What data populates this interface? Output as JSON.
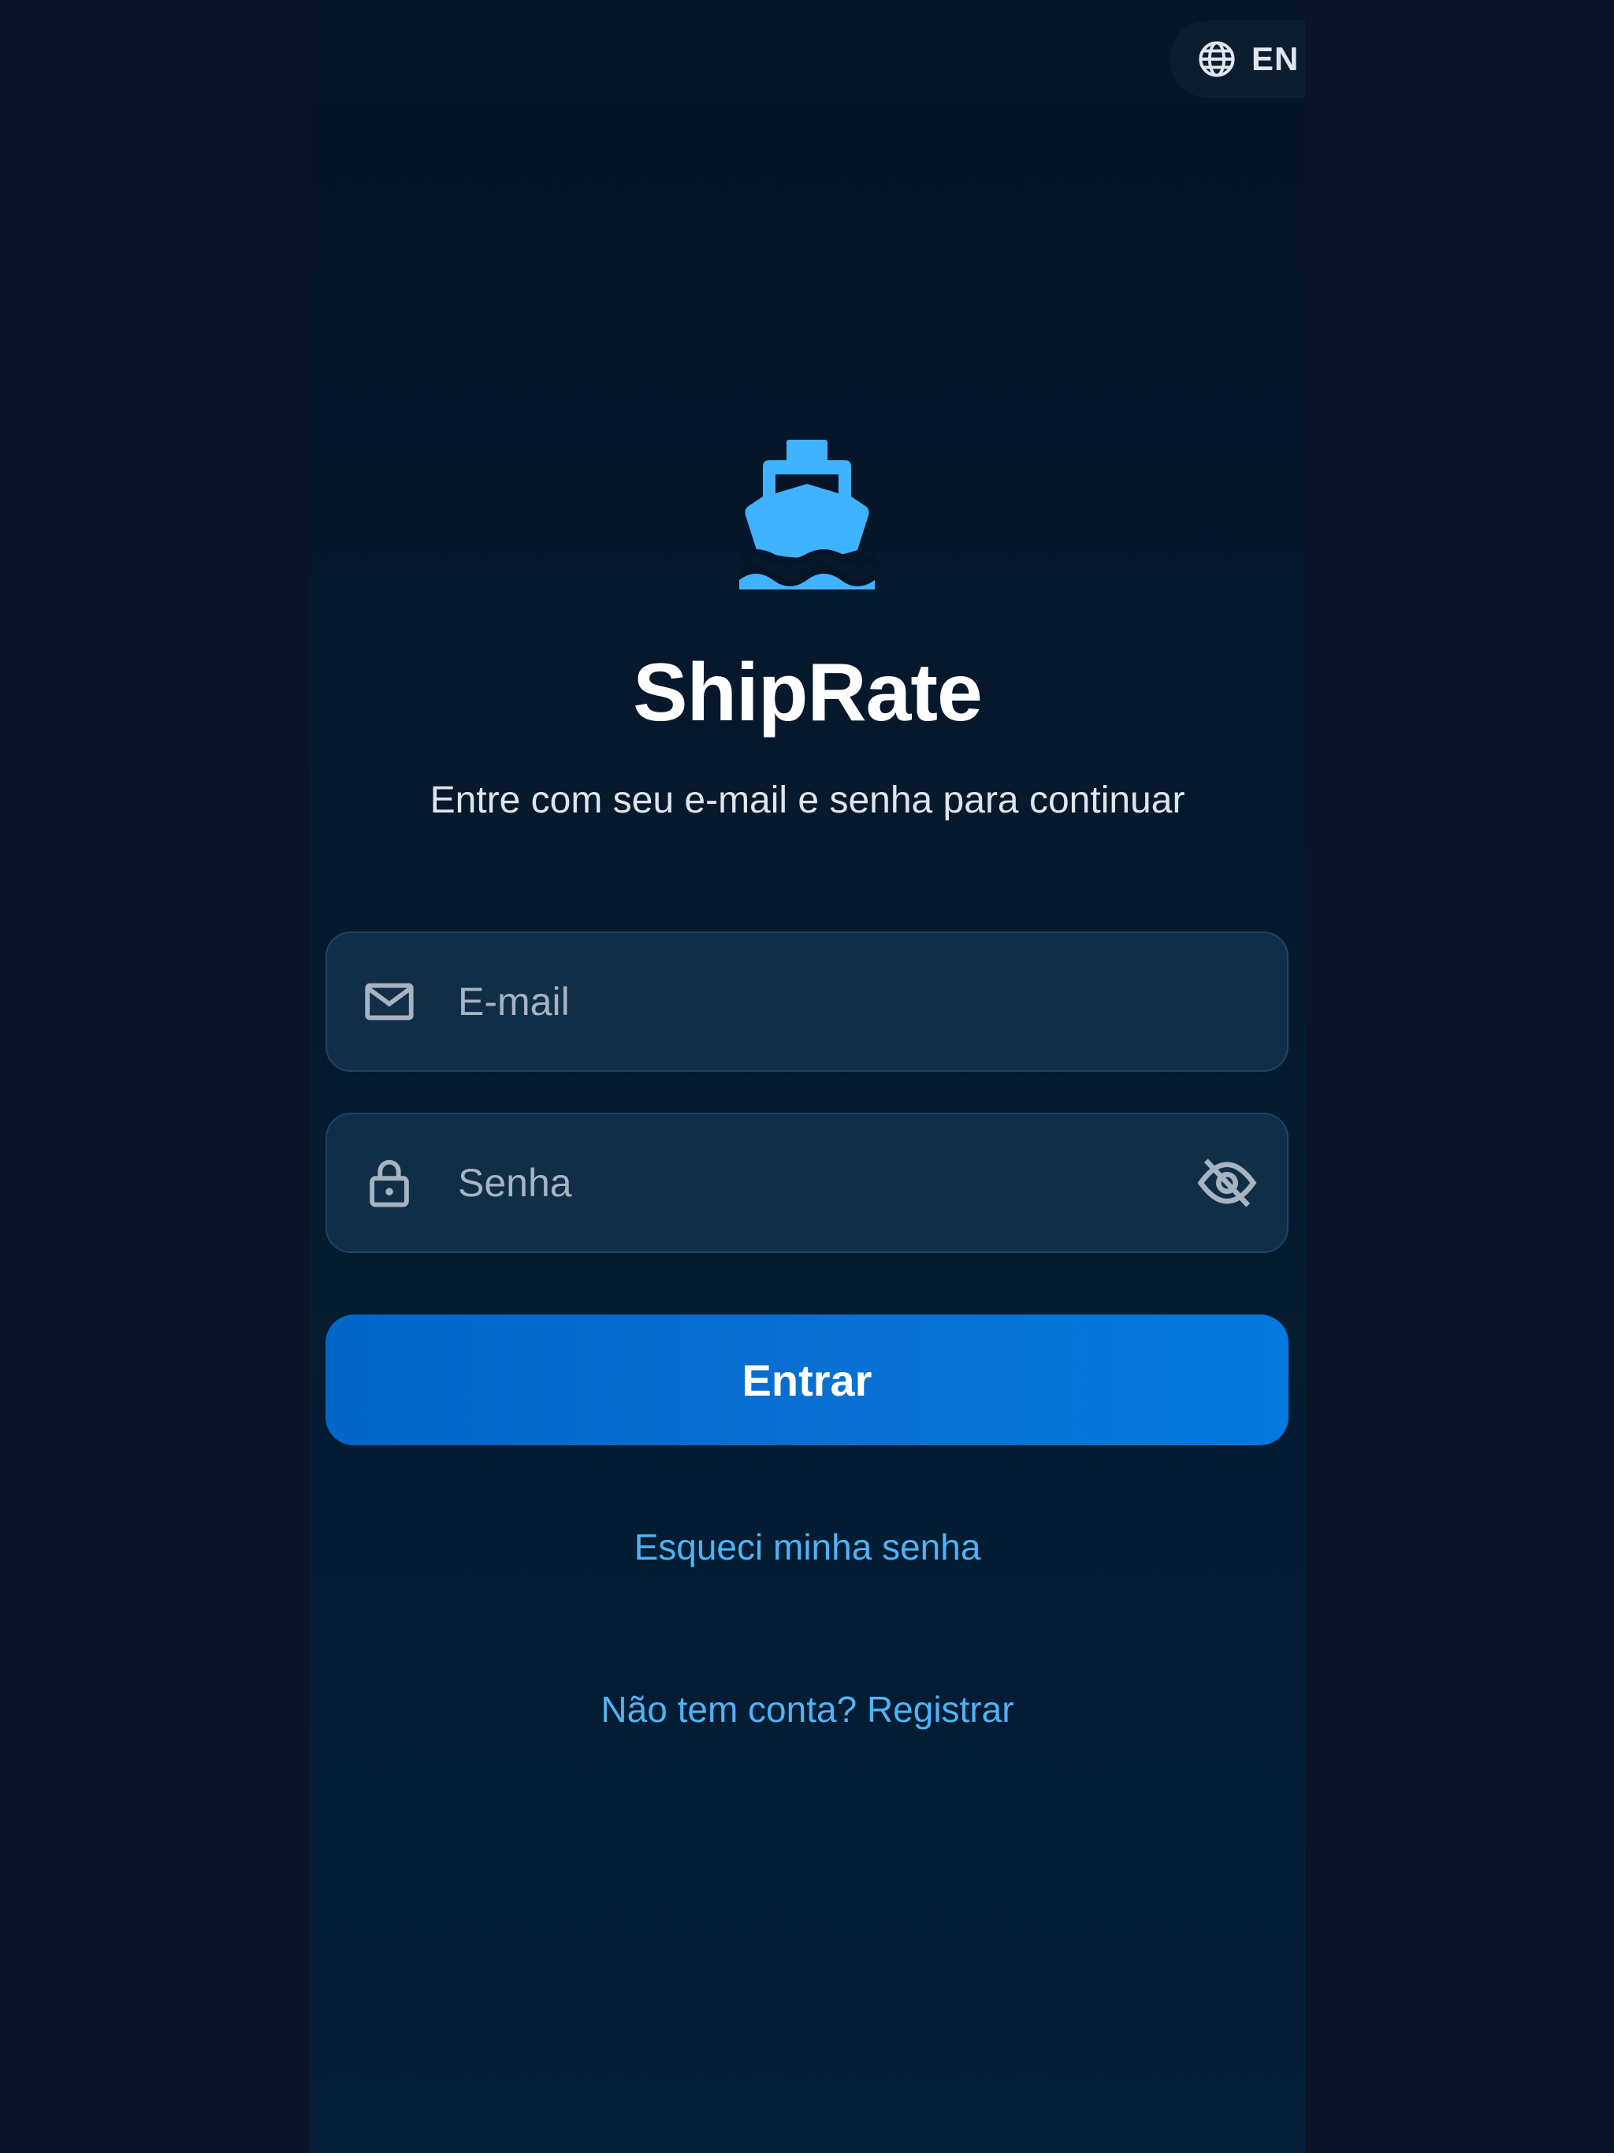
{
  "language_toggle": {
    "icon": "globe-icon",
    "label": "EN"
  },
  "brand": {
    "logo_icon": "ship-icon",
    "logo_color": "#3fb3ff",
    "app_name": "ShipRate",
    "subtitle": "Entre com seu e-mail e senha para continuar"
  },
  "form": {
    "email": {
      "icon": "mail-icon",
      "placeholder": "E-mail",
      "value": ""
    },
    "password": {
      "icon": "lock-icon",
      "placeholder": "Senha",
      "value": "",
      "visibility_icon": "eye-off-icon"
    },
    "submit_label": "Entrar"
  },
  "links": {
    "forgot_password": "Esqueci minha senha",
    "register": "Não tem conta? Registrar"
  },
  "colors": {
    "background": "#0a1426",
    "accent": "#0a6fd2",
    "link": "#4fb2f5",
    "field_bg": "#112e47"
  }
}
